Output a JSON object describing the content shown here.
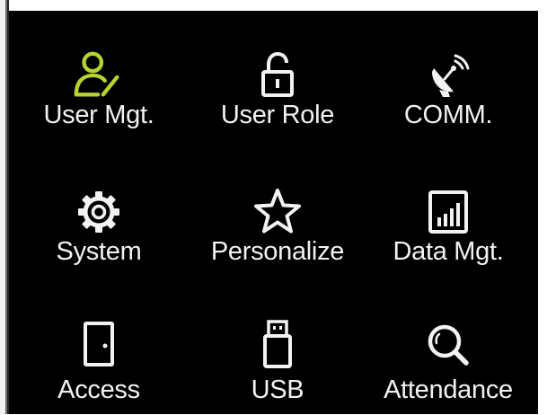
{
  "colors": {
    "screen_background": "#000000",
    "label_text": "#f2f2f2",
    "icon_default": "#f2f2f2",
    "icon_active": "#b5d52e"
  },
  "menu": {
    "items": [
      {
        "label": "User Mgt.",
        "icon": "user-edit-icon",
        "active": true
      },
      {
        "label": "User Role",
        "icon": "lock-icon",
        "active": false
      },
      {
        "label": "COMM.",
        "icon": "satellite-dish-icon",
        "active": false
      },
      {
        "label": "System",
        "icon": "gear-icon",
        "active": false
      },
      {
        "label": "Personalize",
        "icon": "star-icon",
        "active": false
      },
      {
        "label": "Data Mgt.",
        "icon": "bar-chart-icon",
        "active": false
      },
      {
        "label": "Access",
        "icon": "door-icon",
        "active": false
      },
      {
        "label": "USB",
        "icon": "usb-drive-icon",
        "active": false
      },
      {
        "label": "Attendance",
        "icon": "search-icon",
        "active": false
      }
    ]
  }
}
